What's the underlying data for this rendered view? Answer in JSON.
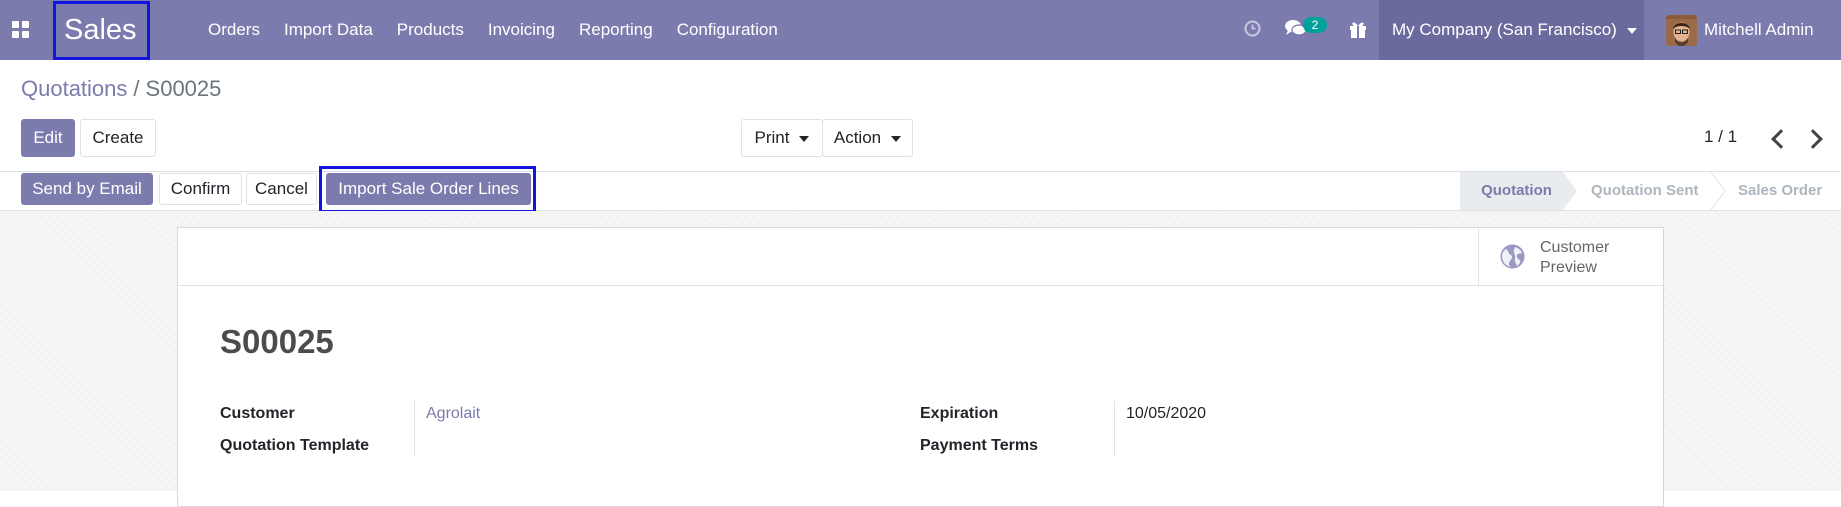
{
  "navbar": {
    "app_name": "Sales",
    "menu": [
      "Orders",
      "Import Data",
      "Products",
      "Invoicing",
      "Reporting",
      "Configuration"
    ],
    "message_count": "2",
    "company": "My Company (San Francisco)",
    "user": "Mitchell Admin"
  },
  "breadcrumb": {
    "parent": "Quotations",
    "separator": "/",
    "current": "S00025"
  },
  "control": {
    "edit_label": "Edit",
    "create_label": "Create",
    "print_label": "Print",
    "action_label": "Action",
    "pager": "1 / 1"
  },
  "statusbar": {
    "buttons": [
      "Send by Email",
      "Confirm",
      "Cancel",
      "Import Sale Order Lines"
    ],
    "stages": [
      "Quotation",
      "Quotation Sent",
      "Sales Order"
    ],
    "active_stage": "Quotation"
  },
  "form": {
    "smart_button": "Customer Preview",
    "name": "S00025",
    "fields": {
      "customer_label": "Customer",
      "customer_value": "Agrolait",
      "template_label": "Quotation Template",
      "template_value": "",
      "expiration_label": "Expiration",
      "expiration_value": "10/05/2020",
      "payment_terms_label": "Payment Terms",
      "payment_terms_value": ""
    }
  },
  "colors": {
    "brand": "#7c7bad",
    "highlight": "#1414e0",
    "badge": "#00a09d"
  },
  "icons": [
    "apps-grid-icon",
    "clock-icon",
    "chat-icon",
    "gift-icon",
    "caret-down-icon",
    "globe-icon",
    "chevron-left-icon",
    "chevron-right-icon"
  ]
}
